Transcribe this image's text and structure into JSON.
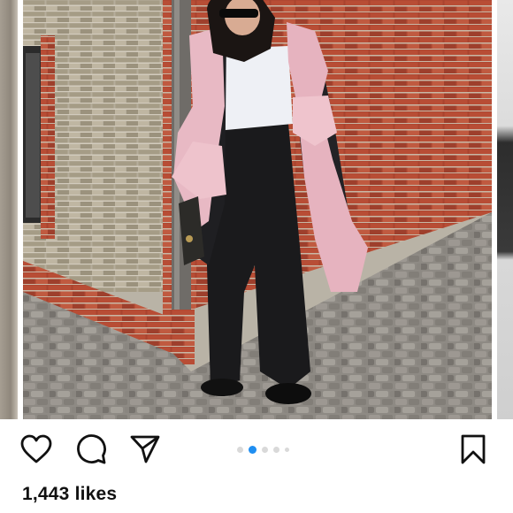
{
  "post": {
    "likes_text": "1,443 likes",
    "carousel": {
      "total_slides": 5,
      "active_slide_index": 1
    },
    "actions": [
      {
        "name": "like-button",
        "icon": "heart-icon"
      },
      {
        "name": "comment-button",
        "icon": "comment-bubble-icon"
      },
      {
        "name": "share-button",
        "icon": "paper-plane-icon"
      },
      {
        "name": "save-button",
        "icon": "bookmark-icon"
      }
    ],
    "colors": {
      "active_dot": "#1f8ef1",
      "inactive_dot": "#d9d9d9",
      "text": "#111111"
    }
  }
}
